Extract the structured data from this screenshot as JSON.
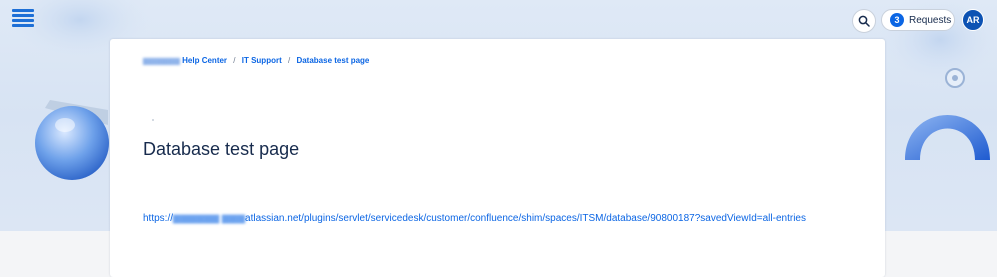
{
  "header": {
    "menu_icon": "hamburger-menu-icon",
    "search_icon": "search-icon",
    "requests_count": "3",
    "requests_label": "Requests",
    "avatar_initials": "AR"
  },
  "breadcrumb": {
    "items": [
      "Help Center",
      "IT Support",
      "Database test page"
    ],
    "separator": "/"
  },
  "page": {
    "title": "Database test page",
    "link_prefix": "https://",
    "link_suffix": "atlassian.net/plugins/servlet/servicedesk/customer/confluence/shim/spaces/ITSM/database/90800187?savedViewId=all-entries"
  },
  "colors": {
    "accent": "#0c66e4",
    "banner": "#dfe9f6",
    "title": "#172b4d"
  }
}
